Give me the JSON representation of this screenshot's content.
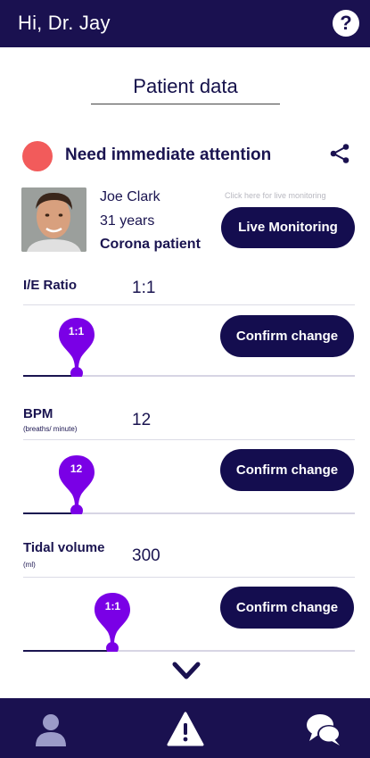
{
  "header": {
    "greeting": "Hi, Dr. Jay",
    "help_label": "?"
  },
  "page": {
    "title": "Patient data"
  },
  "status": {
    "text": "Need immediate attention",
    "color": "#f25b5b"
  },
  "patient": {
    "name": "Joe Clark",
    "age": "31 years",
    "condition": "Corona patient"
  },
  "live": {
    "hint": "Click here for live monitoring",
    "button_label": "Live Monitoring"
  },
  "params": [
    {
      "label": "I/E Ratio",
      "unit": "",
      "value": "1:1",
      "slider_label": "1:1",
      "slider_fraction": 0.16,
      "confirm_label": "Confirm change"
    },
    {
      "label": "BPM",
      "unit": "(breaths/ minute)",
      "value": "12",
      "slider_label": "12",
      "slider_fraction": 0.16,
      "confirm_label": "Confirm change"
    },
    {
      "label": "Tidal volume",
      "unit": "(ml)",
      "value": "300",
      "slider_label": "1:1",
      "slider_fraction": 0.27,
      "confirm_label": "Confirm change"
    }
  ],
  "icons": {
    "share": "share-icon",
    "more": "chevron-down-icon",
    "nav": [
      "user-icon",
      "alert-icon",
      "chat-icon"
    ]
  },
  "colors": {
    "primary": "#1a1150",
    "accent": "#7a00e6",
    "alert": "#f25b5b"
  }
}
